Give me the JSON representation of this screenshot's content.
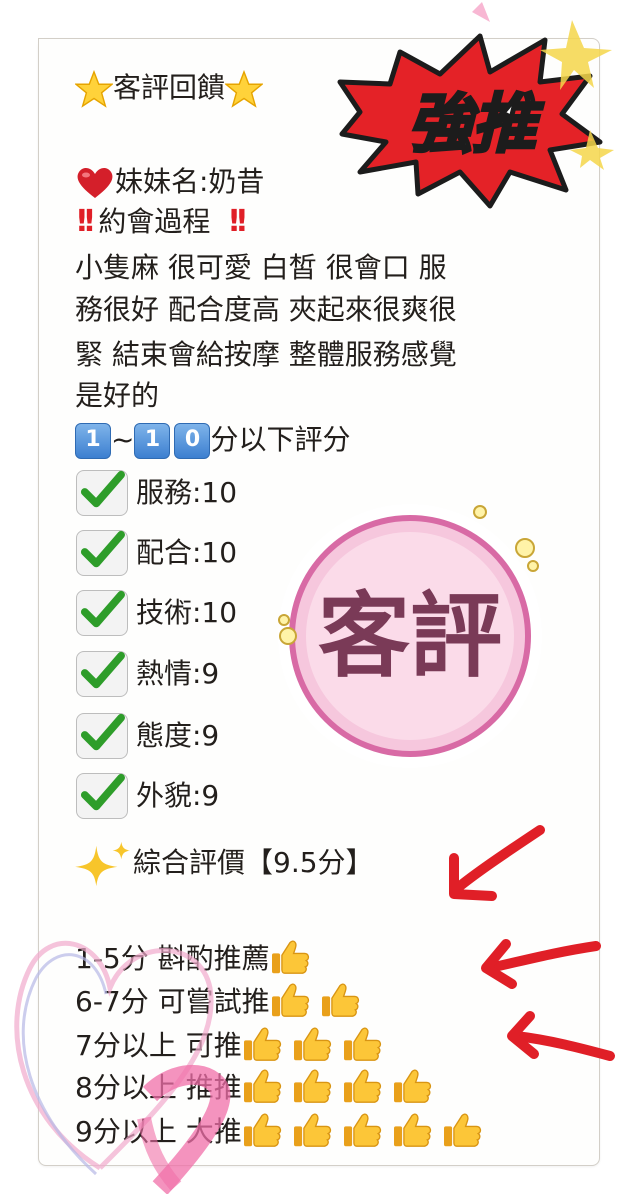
{
  "title": "客評回饋",
  "girl_name_line": "妹妹名:奶昔",
  "process_title": "約會過程",
  "process_lines": [
    "小隻麻 很可愛 白皙 很會口 服",
    "務很好 配合度高 夾起來很爽很",
    "緊 結束會給按摩 整體服務感覺",
    "是好的"
  ],
  "scale": {
    "from": "1",
    "to_1": "1",
    "to_2": "0",
    "tilde": "~",
    "text": "分以下評分"
  },
  "scores": [
    {
      "label": "服務:10"
    },
    {
      "label": "配合:10"
    },
    {
      "label": "技術:10"
    },
    {
      "label": "熱情:9"
    },
    {
      "label": "態度:9"
    },
    {
      "label": "外貌:9"
    }
  ],
  "overall": "綜合評價【9.5分】",
  "legend": [
    {
      "text": "1-5分 斟酌推薦",
      "thumbs": 1
    },
    {
      "text": "6-7分 可嘗試推",
      "thumbs": 2
    },
    {
      "text": "7分以上 可推",
      "thumbs": 3
    },
    {
      "text": "8分以上 推推",
      "thumbs": 4
    },
    {
      "text": "9分以上 大推",
      "thumbs": 5
    }
  ],
  "sticker_badge": "客評",
  "sticker_burst": "強推",
  "colors": {
    "accent_red": "#e01f27",
    "badge_pink": "#f6c7dd",
    "badge_ring": "#d86aa5",
    "badge_text": "#7a3a57"
  }
}
